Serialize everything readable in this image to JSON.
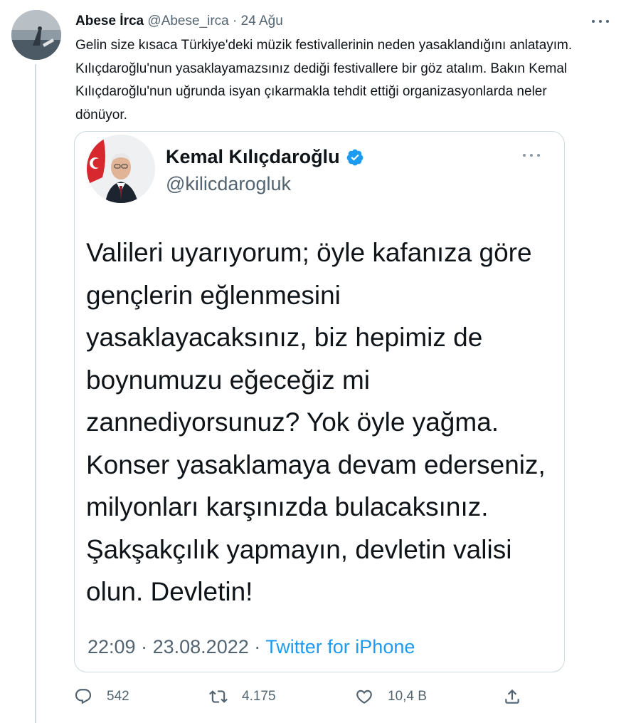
{
  "tweet": {
    "author_name": "Abese İrca",
    "author_handle": "@Abese_irca",
    "separator": "·",
    "date": "24 Ağu",
    "text": "Gelin size kısaca Türkiye'deki müzik festivallerinin neden yasaklandığını anlatayım. Kılıçdaroğlu'nun yasaklayamazsınız dediği festivallere bir göz atalım. Bakın Kemal Kılıçdaroğlu'nun uğrunda isyan çıkarmakla tehdit ettiği organizasyonlarda neler dönüyor."
  },
  "quoted": {
    "name": "Kemal Kılıçdaroğlu",
    "handle": "@kilicdarogluk",
    "text": "Valileri uyarıyorum; öyle kafanıza göre gençlerin eğlenmesini yasaklayacaksınız, biz hepimiz de boynumuzu eğeceğiz mi zannediyorsunuz? Yok öyle yağma. Konser yasaklamaya devam ederseniz, milyonları karşınızda bulacaksınız. Şakşakçılık yapmayın, devletin valisi olun. Devletin!",
    "time": "22:09",
    "separator": "·",
    "date": "23.08.2022",
    "source": "Twitter for iPhone"
  },
  "actions": {
    "replies": "542",
    "retweets": "4.175",
    "likes": "10,4 B"
  },
  "colors": {
    "text": "#0f1419",
    "secondary": "#536471",
    "link": "#1d9bf0",
    "verified": "#1d9bf0",
    "border": "#cfd9de"
  },
  "icons": {
    "more": "more-horizontal-icon",
    "verified": "verified-badge-icon",
    "reply": "reply-icon",
    "retweet": "retweet-icon",
    "like": "heart-icon",
    "share": "share-icon"
  }
}
